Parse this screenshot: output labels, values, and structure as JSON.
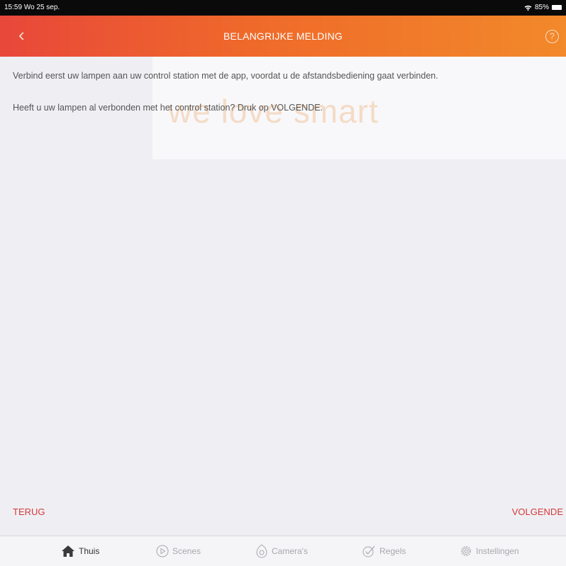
{
  "status": {
    "time": "15:59",
    "date": "Wo 25 sep.",
    "battery": "85%"
  },
  "header": {
    "back_icon": "‹",
    "title": "BELANGRIJKE MELDING",
    "help_icon": "?"
  },
  "watermark": {
    "tagline": "we love smart"
  },
  "content": {
    "line1": "Verbind eerst uw lampen aan uw control station met de app, voordat u de afstandsbediening gaat verbinden.",
    "line2": "Heeft u uw lampen al verbonden met het control station? Druk op VOLGENDE."
  },
  "actions": {
    "back": "TERUG",
    "next": "VOLGENDE"
  },
  "tabs": [
    {
      "label": "Thuis",
      "icon": "home-icon",
      "active": true
    },
    {
      "label": "Scenes",
      "icon": "play-circle-icon",
      "active": false
    },
    {
      "label": "Camera's",
      "icon": "camera-icon",
      "active": false
    },
    {
      "label": "Regels",
      "icon": "check-circle-icon",
      "active": false
    },
    {
      "label": "Instellingen",
      "icon": "gear-icon",
      "active": false
    }
  ],
  "colors": {
    "accent": "#d23a3a",
    "header_start": "#e8473a",
    "header_end": "#f2892a"
  }
}
